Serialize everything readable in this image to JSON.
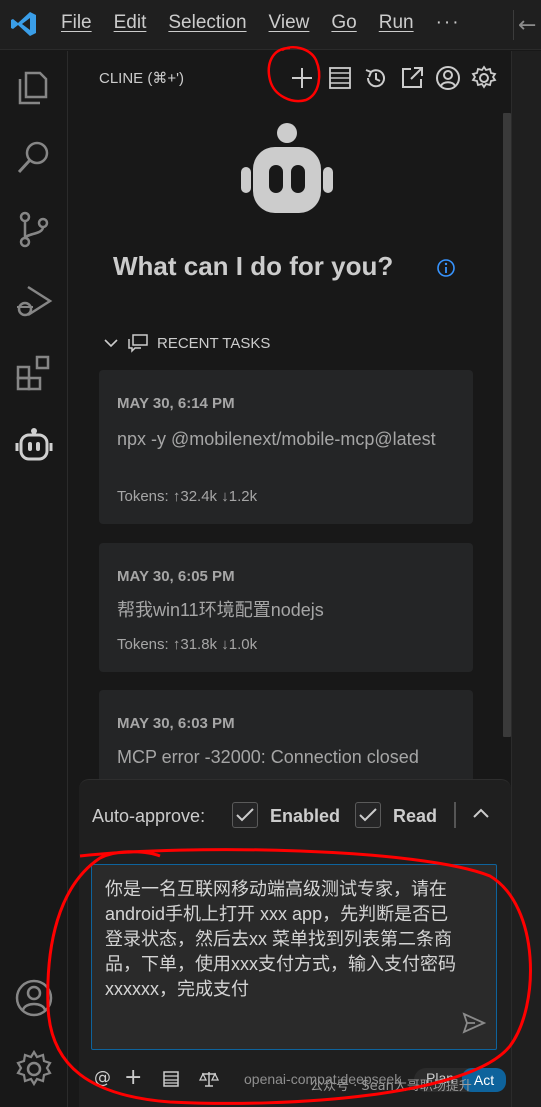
{
  "menu": {
    "items": [
      "File",
      "Edit",
      "Selection",
      "View",
      "Go",
      "Run"
    ],
    "more": "···"
  },
  "sidebar": {
    "title": "CLINE (⌘+')"
  },
  "welcome": {
    "heading": "What can I do for you?"
  },
  "recent": {
    "label": "RECENT TASKS",
    "tasks": [
      {
        "date": "MAY 30, 6:14 PM",
        "text": "npx -y @mobilenext/mobile-mcp@latest",
        "tokens": "Tokens: ↑32.4k ↓1.2k"
      },
      {
        "date": "MAY 30, 6:05 PM",
        "text": "帮我win11环境配置nodejs",
        "tokens": "Tokens: ↑31.8k ↓1.0k"
      },
      {
        "date": "MAY 30, 6:03 PM",
        "text": "MCP error -32000: Connection closed",
        "tokens": ""
      }
    ]
  },
  "auto_approve": {
    "label": "Auto-approve:",
    "enabled_label": "Enabled",
    "read_label": "Read"
  },
  "input": {
    "value": "你是一名互联网移动端高级测试专家，请在android手机上打开 xxx app，先判断是否已登录状态，然后去xx 菜单找到列表第二条商品，下单，使用xxx支付方式，输入支付密码xxxxxx，完成支付"
  },
  "bottom_bar": {
    "at": "@",
    "plus": "+",
    "model": "openai-compat:deepseek",
    "plan": "Plan",
    "act": "Act"
  },
  "watermark": "公众号 · Sean大哥职场提升",
  "colors": {
    "accent": "#0e639c",
    "annotation": "#ff0000"
  }
}
